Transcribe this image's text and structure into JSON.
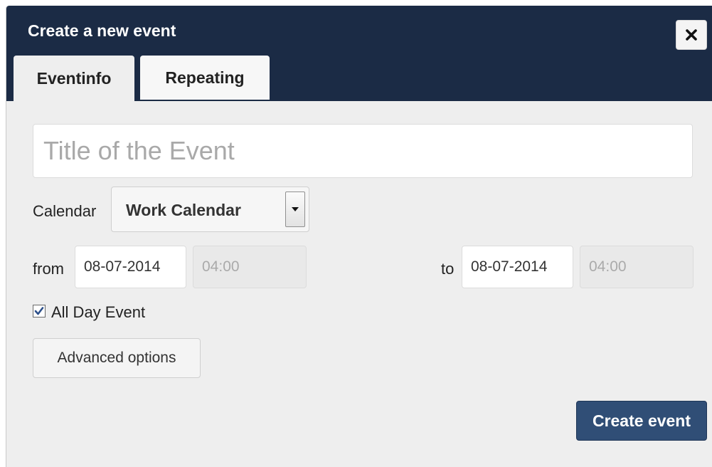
{
  "dialog": {
    "title": "Create a new event",
    "close_icon": "close-icon"
  },
  "tabs": [
    {
      "label": "Eventinfo",
      "active": true
    },
    {
      "label": "Repeating",
      "active": false
    }
  ],
  "form": {
    "title_placeholder": "Title of the Event",
    "title_value": "",
    "calendar_label": "Calendar",
    "calendar_value": "Work Calendar",
    "from_label": "from",
    "from_date": "08-07-2014",
    "from_time": "04:00",
    "to_label": "to",
    "to_date": "08-07-2014",
    "to_time": "04:00",
    "all_day_label": "All Day Event",
    "all_day_checked": true,
    "advanced_label": "Advanced options",
    "submit_label": "Create event"
  },
  "colors": {
    "header": "#1b2b45",
    "panel": "#eeeeee",
    "primary_button": "#304e76"
  }
}
